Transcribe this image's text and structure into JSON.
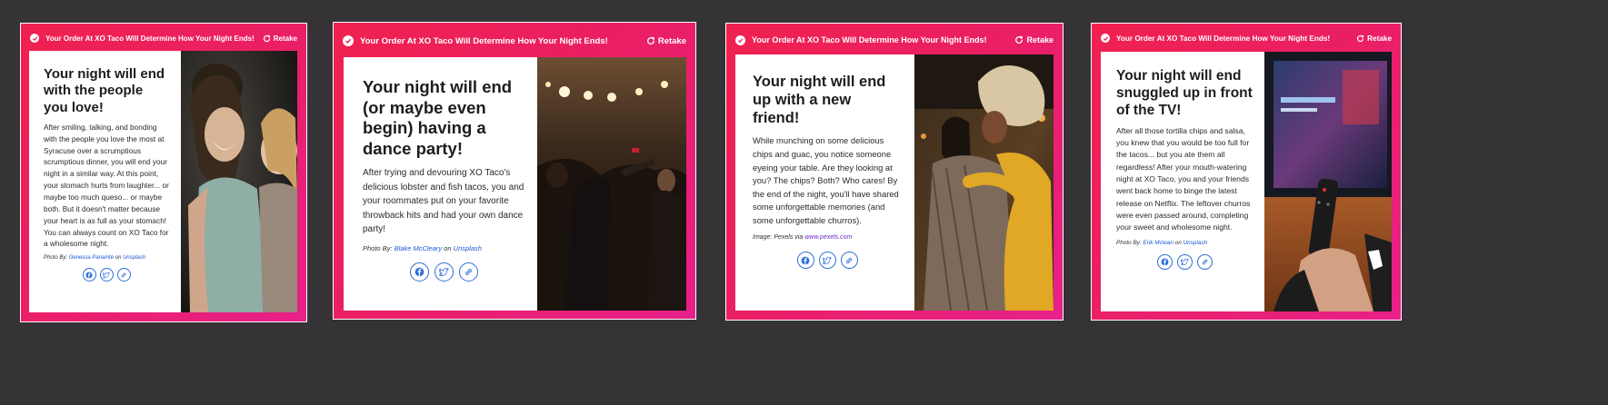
{
  "cards": [
    {
      "header": {
        "title": "Your Order At XO Taco Will Determine How Your Night Ends!",
        "retake": "Retake"
      },
      "headline": "Your night will end with the people you love!",
      "body": "After smiling, talking, and bonding with the people you love the most at Syracuse over a scrumptious scrumptious dinner, you will end your night in a similar way. At this point, your stomach hurts from laughter... or maybe too much queso... or maybe both. But it doesn't matter because your heart is as full as your stomach! You can always count on XO Taco for a wholesome night.",
      "credit": {
        "prefix": "Photo By:",
        "author": "Genessa Panainte",
        "joiner": "on",
        "source": "Unsplash"
      },
      "photo_icon": "friends-laughing-photo"
    },
    {
      "header": {
        "title": "Your Order At XO Taco Will Determine How Your Night Ends!",
        "retake": "Retake"
      },
      "headline": "Your night will end (or maybe even begin) having a dance party!",
      "body": "After trying and devouring XO Taco's delicious lobster and fish tacos, you and your roommates put on your favorite throwback hits and had your own dance party!",
      "credit": {
        "prefix": "Photo By:",
        "author": "Blake McCleary",
        "joiner": "on",
        "source": "Unsplash"
      },
      "photo_icon": "dance-party-photo"
    },
    {
      "header": {
        "title": "Your Order At XO Taco Will Determine How Your Night Ends!",
        "retake": "Retake"
      },
      "headline": "Your night will end up with a new friend!",
      "body": "While munching on some delicious chips and guac, you notice someone eyeing your table. Are they looking at you? The chips? Both? Who cares! By the end of the night, you'll have shared some unforgettable memories (and some unforgettable churros).",
      "credit": {
        "prefix": "Image: Pexels via",
        "author": "www.pexels.com",
        "joiner": "",
        "source": ""
      },
      "photo_icon": "hug-photo"
    },
    {
      "header": {
        "title": "Your Order At XO Taco Will Determine How Your Night Ends!",
        "retake": "Retake"
      },
      "headline": "Your night will end snuggled up in front of the TV!",
      "body": "After all those tortilla chips and salsa, you knew that you would be too full for the tacos... but you ate them all regardless! After your mouth-watering night at XO Taco, you and your friends went back home to binge the latest release on Netflix. The leftover churros were even passed around, completing your sweet and wholesome night.",
      "credit": {
        "prefix": "Photo By:",
        "author": "Erik Mclean",
        "joiner": "on",
        "source": "Unsplash"
      },
      "photo_icon": "tv-remote-photo"
    }
  ],
  "share_icons": [
    "facebook-icon",
    "twitter-icon",
    "link-icon"
  ],
  "colors": {
    "background": "#353335",
    "accent_gradient_start": "#f0214f",
    "accent_gradient_end": "#e8208a",
    "share_blue": "#2f6fd6",
    "link_blue": "#1b58d8"
  }
}
